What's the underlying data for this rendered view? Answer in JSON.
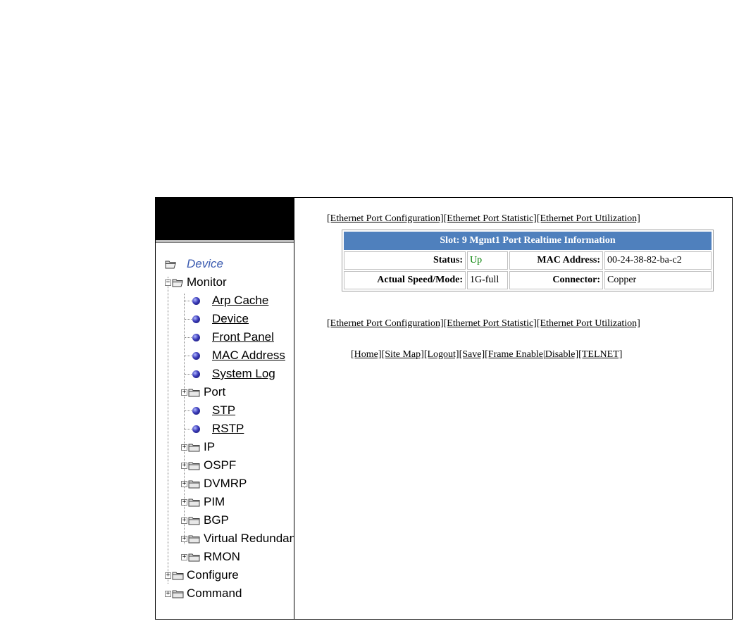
{
  "tree": {
    "root": {
      "label": "Device",
      "icon": "folder-open-icon"
    },
    "monitor": {
      "label": "Monitor",
      "icon": "folder-open-icon"
    },
    "monitor_items": [
      {
        "label": "Arp Cache",
        "type": "link"
      },
      {
        "label": "Device",
        "type": "link"
      },
      {
        "label": "Front Panel",
        "type": "link"
      },
      {
        "label": "MAC Address",
        "type": "link"
      },
      {
        "label": "System Log",
        "type": "link"
      },
      {
        "label": "Port",
        "type": "folder"
      },
      {
        "label": "STP",
        "type": "link"
      },
      {
        "label": "RSTP",
        "type": "link"
      },
      {
        "label": "IP",
        "type": "folder"
      },
      {
        "label": "OSPF",
        "type": "folder"
      },
      {
        "label": "DVMRP",
        "type": "folder"
      },
      {
        "label": "PIM",
        "type": "folder"
      },
      {
        "label": "BGP",
        "type": "folder"
      },
      {
        "label": "Virtual Redundancy",
        "type": "folder"
      },
      {
        "label": "RMON",
        "type": "folder"
      }
    ],
    "configure": {
      "label": "Configure"
    },
    "command": {
      "label": "Command"
    }
  },
  "top_links": {
    "config": "[Ethernet Port Configuration]",
    "statistic": "[Ethernet Port Statistic]",
    "utilization": "[Ethernet Port Utilization]"
  },
  "table": {
    "title": "Slot: 9 Mgmt1 Port Realtime Information",
    "status_label": "Status:",
    "status_value": "Up",
    "mac_label": "MAC Address:",
    "mac_value": "00-24-38-82-ba-c2",
    "speed_label": "Actual Speed/Mode:",
    "speed_value": "1G-full",
    "connector_label": "Connector:",
    "connector_value": "Copper"
  },
  "footer": {
    "home": "[Home]",
    "sitemap": "[Site Map]",
    "logout": "[Logout]",
    "save": "[Save]",
    "frame_enable": "[Frame Enable",
    "separator": "|",
    "disable": "Disable]",
    "telnet": "[TELNET]"
  },
  "colors": {
    "table_header_bg": "#4f80bd",
    "status_up": "#008000",
    "root_label": "#3b5bb0"
  }
}
